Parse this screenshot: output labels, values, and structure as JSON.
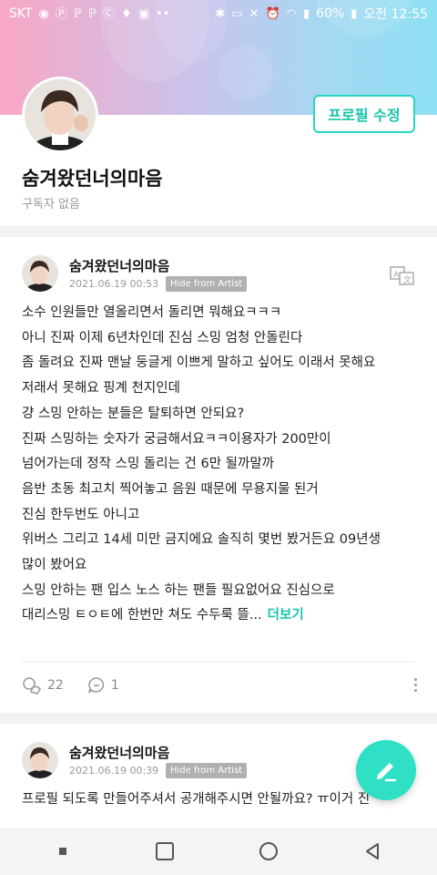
{
  "status_bar": {
    "carrier": "SKT",
    "battery": "60%",
    "time": "오전 12:55"
  },
  "profile": {
    "name": "숨겨왔던너의마음",
    "subscribers": "구독자 없음",
    "edit_button": "프로필 수정"
  },
  "posts": [
    {
      "author": "숨겨왔던너의마음",
      "date": "2021.06.19 00:53",
      "badge": "Hide from Artist",
      "lines": [
        "소수 인원들만 열올리면서 돌리면 뭐해요ㅋㅋㅋ",
        "아니 진짜 이제 6년차인데 진심 스밍 엄청 안돌린다",
        "좀 돌려요 진짜 맨날 둥글게 이쁘게 말하고 싶어도 이래서 못해요",
        "저래서 못해요 핑계 천지인데",
        "걍 스밍 안하는 분들은 탈퇴하면 안되요?",
        "진짜 스밍하는 숫자가 궁금해서요ㅋㅋ이용자가 200만이",
        "넘어가는데 정작 스밍 돌리는 건 6만 될까말까",
        "음반 초동 최고치 찍어놓고 음원 때문에 무용지물 된거",
        "진심 한두번도 아니고",
        "위버스 그리고 14세 미만 금지에요 솔직히 몇번 봤거든요 09년생",
        "많이 봤어요",
        "스밍 안하는 팬 입스 노스 하는 팬들 필요없어요 진심으로",
        "대리스밍 ㅌㅇㅌ에 한번만 쳐도 수두룩 뜰..."
      ],
      "more": "더보기",
      "likes": "22",
      "comments": "1"
    },
    {
      "author": "숨겨왔던너의마음",
      "date": "2021.06.19 00:39",
      "badge": "Hide from Artist",
      "lines": [
        "프로필 되도록 만들어주셔서 공개해주시면 안될까요? ㅠ이거 진"
      ]
    }
  ],
  "colors": {
    "accent": "#26d7bf",
    "gradient_start": "#f9a7c4",
    "gradient_end": "#8fe0f4"
  }
}
